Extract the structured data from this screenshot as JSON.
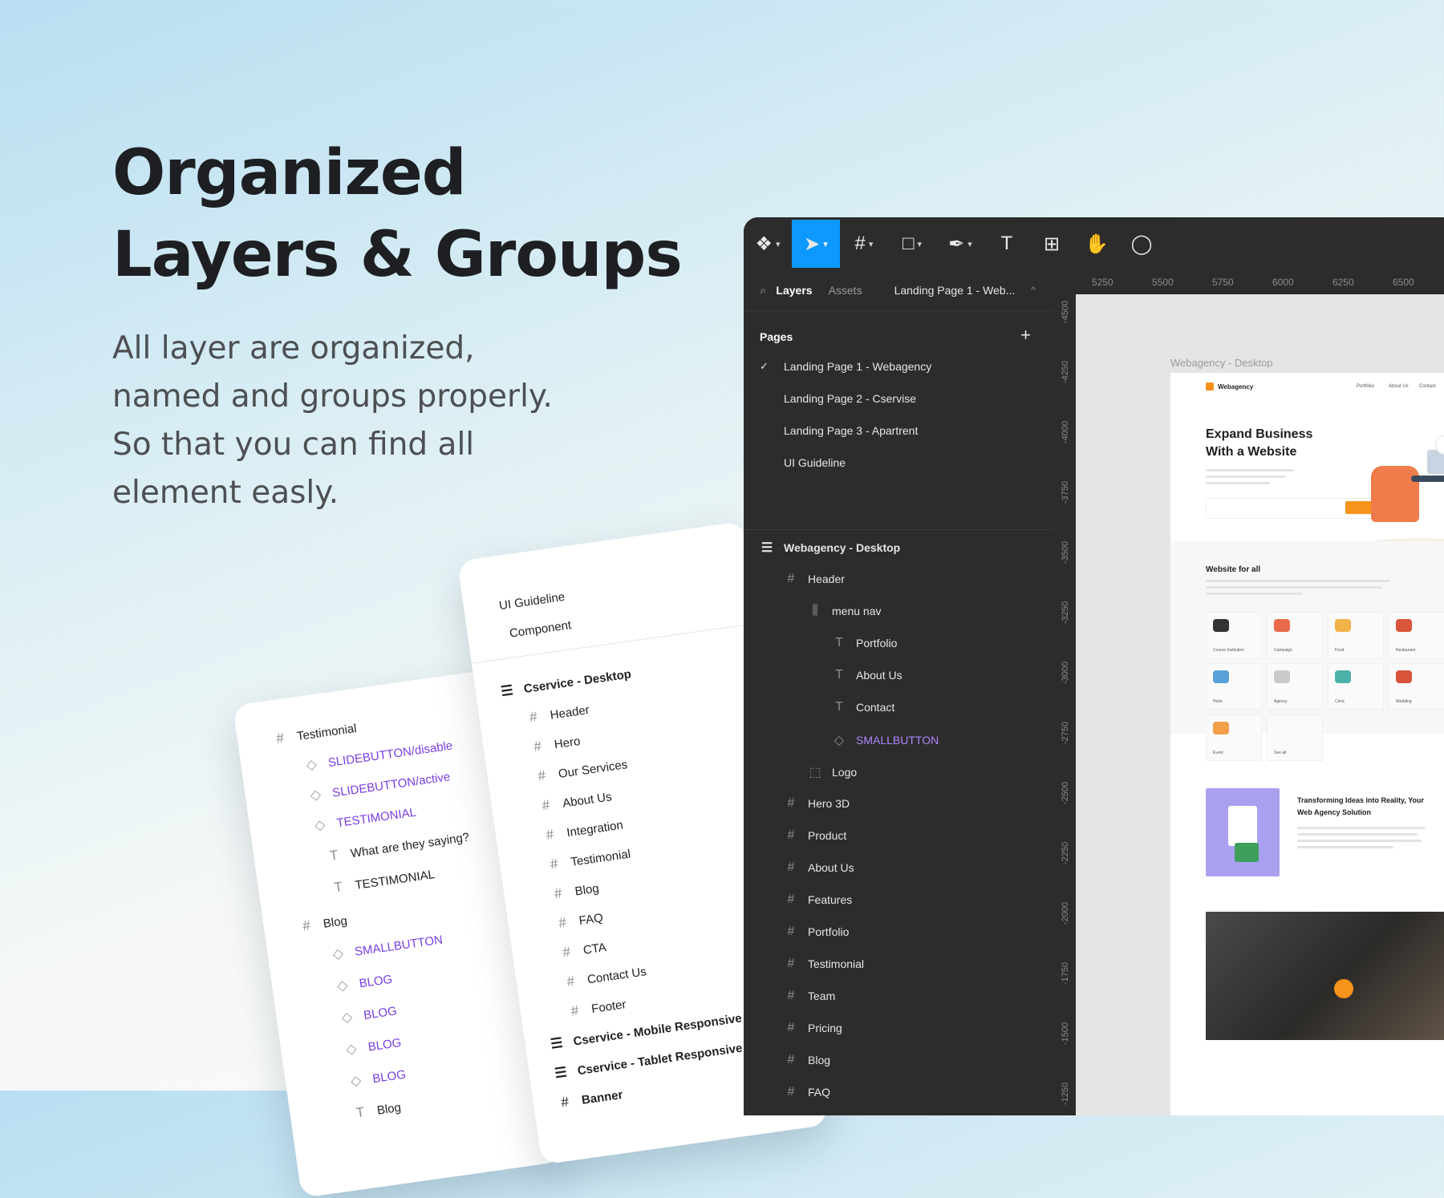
{
  "hero": {
    "title_line1": "Organized",
    "title_line2": "Layers & Groups",
    "desc_line1": "All layer are organized,",
    "desc_line2": "named and groups properly.",
    "desc_line3": "So that you can find all",
    "desc_line4": "element easly."
  },
  "card_left": {
    "rows": [
      {
        "label": "Testimonial",
        "icon": "frame-icon"
      },
      {
        "label": "SLIDEBUTTON/disable",
        "icon": "component-icon"
      },
      {
        "label": "SLIDEBUTTON/active",
        "icon": "component-icon"
      },
      {
        "label": "TESTIMONIAL",
        "icon": "component-icon"
      },
      {
        "label": "What are they saying?",
        "icon": "text-icon"
      },
      {
        "label": "TESTIMONIAL",
        "icon": "text-icon"
      },
      {
        "label": "Blog",
        "icon": "frame-icon"
      },
      {
        "label": "SMALLBUTTON",
        "icon": "component-icon"
      },
      {
        "label": "BLOG",
        "icon": "component-icon"
      },
      {
        "label": "BLOG",
        "icon": "component-icon"
      },
      {
        "label": "BLOG",
        "icon": "component-icon"
      },
      {
        "label": "BLOG",
        "icon": "component-icon"
      },
      {
        "label": "Blog",
        "icon": "text-icon"
      }
    ]
  },
  "card_right": {
    "pages": [
      "UI Guideline",
      "Component"
    ],
    "rows": [
      {
        "label": "Cservice - Desktop",
        "icon": "section-icon"
      },
      {
        "label": "Header",
        "icon": "frame-icon"
      },
      {
        "label": "Hero",
        "icon": "frame-icon"
      },
      {
        "label": "Our Services",
        "icon": "frame-icon"
      },
      {
        "label": "About Us",
        "icon": "frame-icon"
      },
      {
        "label": "Integration",
        "icon": "frame-icon"
      },
      {
        "label": "Testimonial",
        "icon": "frame-icon"
      },
      {
        "label": "Blog",
        "icon": "frame-icon"
      },
      {
        "label": "FAQ",
        "icon": "frame-icon"
      },
      {
        "label": "CTA",
        "icon": "frame-icon"
      },
      {
        "label": "Contact Us",
        "icon": "frame-icon"
      },
      {
        "label": "Footer",
        "icon": "frame-icon"
      },
      {
        "label": "Cservice - Mobile Responsive",
        "icon": "section-icon"
      },
      {
        "label": "Cservice - Tablet Responsive",
        "icon": "section-icon"
      },
      {
        "label": "Banner",
        "icon": "frame-icon"
      }
    ]
  },
  "figma": {
    "tabs": {
      "layers": "Layers",
      "assets": "Assets",
      "page_select": "Landing Page 1 - Web..."
    },
    "pages_title": "Pages",
    "pages": [
      "Landing Page 1 - Webagency",
      "Landing Page 2 - Cservise",
      "Landing Page 3 - Apartrent",
      "UI Guideline"
    ],
    "layers": [
      {
        "label": "Webagency - Desktop",
        "icon": "section-icon",
        "depth": 0,
        "bold": true
      },
      {
        "label": "Header",
        "icon": "frame-icon",
        "depth": 1
      },
      {
        "label": "menu nav",
        "icon": "autolayout-icon",
        "depth": 2
      },
      {
        "label": "Portfolio",
        "icon": "text-icon",
        "depth": 3
      },
      {
        "label": "About Us",
        "icon": "text-icon",
        "depth": 3
      },
      {
        "label": "Contact",
        "icon": "text-icon",
        "depth": 3
      },
      {
        "label": "SMALLBUTTON",
        "icon": "component-icon",
        "depth": 3,
        "component": true
      },
      {
        "label": "Logo",
        "icon": "group-icon",
        "depth": 2
      },
      {
        "label": "Hero 3D",
        "icon": "frame-icon",
        "depth": 1
      },
      {
        "label": "Product",
        "icon": "frame-icon",
        "depth": 1
      },
      {
        "label": "About Us",
        "icon": "frame-icon",
        "depth": 1
      },
      {
        "label": "Features",
        "icon": "frame-icon",
        "depth": 1
      },
      {
        "label": "Portfolio",
        "icon": "frame-icon",
        "depth": 1
      },
      {
        "label": "Testimonial",
        "icon": "frame-icon",
        "depth": 1
      },
      {
        "label": "Team",
        "icon": "frame-icon",
        "depth": 1
      },
      {
        "label": "Pricing",
        "icon": "frame-icon",
        "depth": 1
      },
      {
        "label": "Blog",
        "icon": "frame-icon",
        "depth": 1
      },
      {
        "label": "FAQ",
        "icon": "frame-icon",
        "depth": 1
      }
    ],
    "ruler_top": [
      "5250",
      "5500",
      "5750",
      "6000",
      "6250",
      "6500"
    ],
    "ruler_left": [
      "-4500",
      "-4250",
      "-4000",
      "-3750",
      "-3500",
      "-3250",
      "-3000",
      "-2750",
      "-2500",
      "-2250",
      "-2000",
      "-1750",
      "-1500",
      "-1250"
    ],
    "frame_label": "Webagency - Desktop",
    "preview": {
      "logo": "Webagency",
      "nav": [
        "Portfolio",
        "About Us",
        "Contact"
      ],
      "headline": "Expand Business With a Website",
      "section_title": "Website for all",
      "tiles": [
        "Course Institution",
        "Campaign",
        "Food",
        "Restaurant",
        "Hotel",
        "Agency",
        "Clinic",
        "Wedding",
        "Event",
        "See all"
      ],
      "feature_title": "Transforming Ideas into Reality, Your Web Agency Solution"
    },
    "accent": "#0d99ff",
    "component_color": "#b186ff"
  }
}
